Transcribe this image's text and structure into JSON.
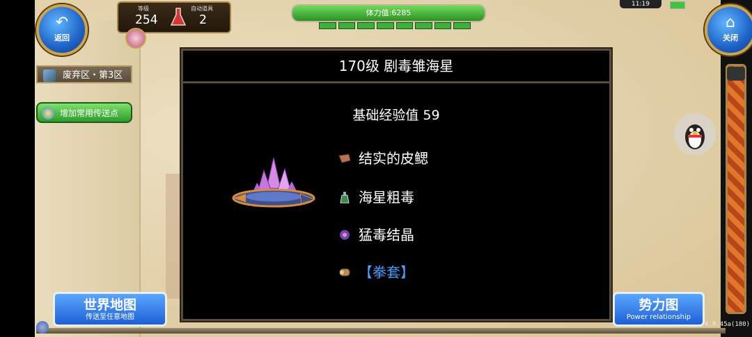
{
  "nav": {
    "back_label": "返回",
    "close_label": "关闭"
  },
  "stats": {
    "level_caption": "等级",
    "level_value": "254",
    "auto_caption": "自动道具",
    "auto_value": "2"
  },
  "stamina": {
    "label": "体力值:6285",
    "pips": 8
  },
  "status": {
    "time": "11:19"
  },
  "location": {
    "zone": "废弃区・第3区",
    "teleport_button": "增加常用传送点"
  },
  "dialog": {
    "title": "170级 剧毒雏海星",
    "base_exp": "基础经验值 59",
    "drops": [
      {
        "name": "结实的皮鳃",
        "icon": "leather-icon",
        "color": "#ffffff"
      },
      {
        "name": "海星粗毒",
        "icon": "potion-icon",
        "color": "#ffffff"
      },
      {
        "name": "猛毒结晶",
        "icon": "orb-icon",
        "color": "#ffffff"
      },
      {
        "name": "【拳套】",
        "icon": "scroll-icon",
        "color": "#4a9bff"
      }
    ]
  },
  "buttons": {
    "world_map_main": "世界地图",
    "world_map_sub": "传送至任意地图",
    "faction_main": "势力图",
    "faction_sub": "Power relationship"
  },
  "version": "4.0.45a(180)"
}
